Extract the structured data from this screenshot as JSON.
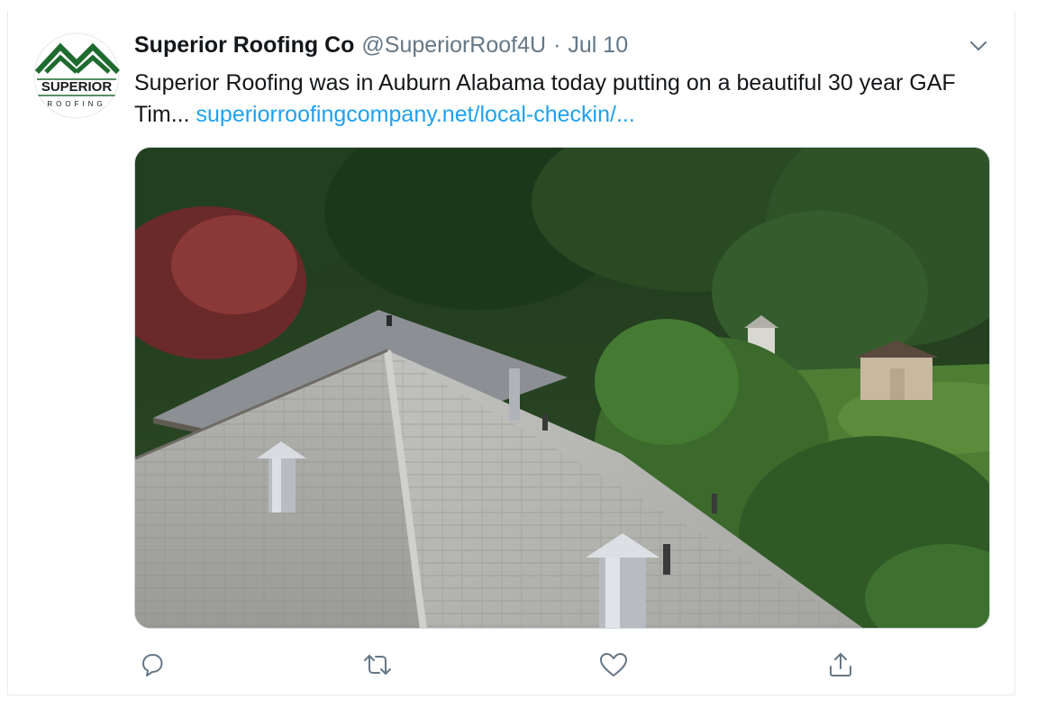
{
  "tweet": {
    "author_name": "Superior Roofing Co",
    "author_handle": "@SuperiorRoof4U",
    "separator": "·",
    "date": "Jul 10",
    "text": "Superior Roofing was in Auburn Alabama today putting on a beautiful 30 year GAF Tim... ",
    "link_text": "superiorroofingcompany.net/local-checkin/..."
  },
  "avatar": {
    "logo_text_top": "SUPERIOR",
    "logo_text_bottom": "ROOFING",
    "logo_color": "#1e6b2f"
  },
  "actions": {
    "reply_icon": "reply-icon",
    "retweet_icon": "retweet-icon",
    "like_icon": "heart-icon",
    "share_icon": "share-icon"
  },
  "colors": {
    "text": "#14171a",
    "muted": "#657786",
    "link": "#1da1f2",
    "border": "#e6ecf0"
  }
}
